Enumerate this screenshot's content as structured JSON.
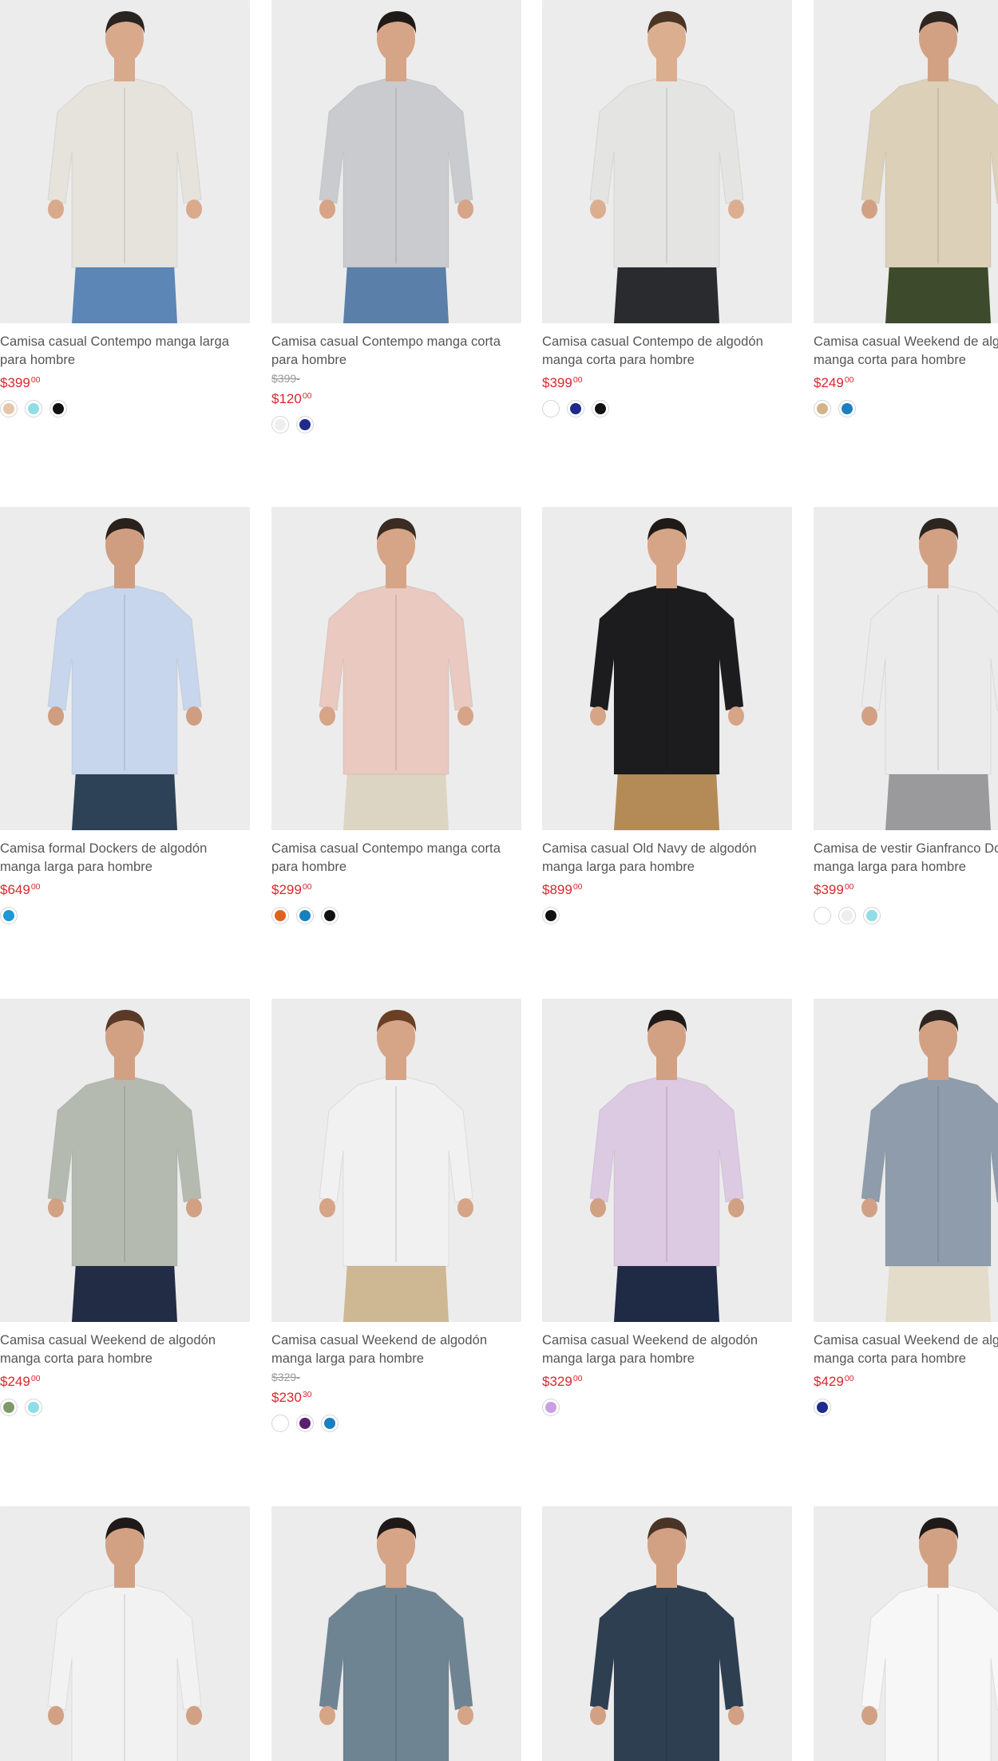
{
  "products": [
    {
      "title": "Camisa casual Contempo manga larga para hombre",
      "old": "",
      "price": "$399",
      "cents": "00",
      "swatches": [
        "#e8c4a8",
        "#8fdde8",
        "#111111"
      ],
      "shirt": "#e6e3dc",
      "pants": "#5b86b5",
      "skin": "#d9a98c",
      "hair": "#2a2420"
    },
    {
      "title": "Camisa casual Contempo manga corta para hombre",
      "old": "$399-",
      "price": "$120",
      "cents": "00",
      "swatches": [
        "#eeeeee",
        "#1e2a8c"
      ],
      "shirt": "#c9cbcf",
      "pants": "#5a7fa8",
      "skin": "#d6a486",
      "hair": "#1f1a18"
    },
    {
      "title": "Camisa casual Contempo de algodón manga corta para hombre",
      "old": "",
      "price": "$399",
      "cents": "00",
      "swatches": [
        "#ffffff",
        "#1e2a8c",
        "#111111"
      ],
      "shirt": "#e4e5e2",
      "pants": "#2a2b2e",
      "skin": "#dcae90",
      "hair": "#4a3426"
    },
    {
      "title": "Camisa casual Weekend de algodón manga corta para hombre",
      "old": "",
      "price": "$249",
      "cents": "00",
      "swatches": [
        "#d3b48a",
        "#1a7fc0"
      ],
      "shirt": "#dcd0b8",
      "pants": "#3d4a2b",
      "skin": "#d2a184",
      "hair": "#2d2520"
    },
    {
      "title": "Camisa formal Dockers de algodón manga larga para hombre",
      "old": "",
      "price": "$649",
      "cents": "00",
      "swatches": [
        "#1a9ad6"
      ],
      "shirt": "#c7d6ec",
      "pants": "#2d4256",
      "skin": "#cf9e80",
      "hair": "#2a211c"
    },
    {
      "title": "Camisa casual Contempo manga corta para hombre",
      "old": "",
      "price": "$299",
      "cents": "00",
      "swatches": [
        "#e0621e",
        "#1a7fc0",
        "#111111"
      ],
      "shirt": "#e9c9c0",
      "pants": "#ddd5c3",
      "skin": "#d6a486",
      "hair": "#3a2c22"
    },
    {
      "title": "Camisa casual Old Navy de algodón manga larga para hombre",
      "old": "",
      "price": "$899",
      "cents": "00",
      "swatches": [
        "#111111"
      ],
      "shirt": "#1c1c1e",
      "pants": "#b48b57",
      "skin": "#d6a486",
      "hair": "#1f1a18"
    },
    {
      "title": "Camisa de vestir Gianfranco Dormi manga larga para hombre",
      "old": "",
      "price": "$399",
      "cents": "00",
      "swatches": [
        "#ffffff",
        "#eeeeee",
        "#8fdde8"
      ],
      "shirt": "#ebebec",
      "pants": "#9a9a9c",
      "skin": "#d2a184",
      "hair": "#2d2520"
    },
    {
      "title": "Camisa casual Weekend de algodón manga corta para hombre",
      "old": "",
      "price": "$249",
      "cents": "00",
      "swatches": [
        "#7f9a68",
        "#8fdde8"
      ],
      "shirt": "#b4bab0",
      "pants": "#222c44",
      "skin": "#d2a184",
      "hair": "#5a3a26"
    },
    {
      "title": "Camisa casual Weekend de algodón manga larga para hombre",
      "old": "$329-",
      "price": "$230",
      "cents": "30",
      "swatches": [
        "#ffffff",
        "#5a1f6e",
        "#1a7fc0"
      ],
      "shirt": "#f1f1f1",
      "pants": "#cdb893",
      "skin": "#d6a486",
      "hair": "#6b3f24"
    },
    {
      "title": "Camisa casual Weekend de algodón manga larga para hombre",
      "old": "",
      "price": "$329",
      "cents": "00",
      "swatches": [
        "#c8a0e0"
      ],
      "shirt": "#dcc9e2",
      "pants": "#1f2a44",
      "skin": "#d2a184",
      "hair": "#1f1a18"
    },
    {
      "title": "Camisa casual Weekend de algodón manga corta para hombre",
      "old": "",
      "price": "$429",
      "cents": "00",
      "swatches": [
        "#1e2a8c"
      ],
      "shirt": "#8e9cab",
      "pants": "#e3dccb",
      "skin": "#d2a184",
      "hair": "#2d2520"
    },
    {
      "title": "",
      "old": "",
      "price": "",
      "cents": "",
      "swatches": [],
      "shirt": "#f2f2f2",
      "pants": "#cccccc",
      "skin": "#d2a184",
      "hair": "#1f1a18"
    },
    {
      "title": "",
      "old": "",
      "price": "",
      "cents": "",
      "swatches": [],
      "shirt": "#6f8492",
      "pants": "#444444",
      "skin": "#d6a486",
      "hair": "#1f1a18"
    },
    {
      "title": "",
      "old": "",
      "price": "",
      "cents": "",
      "swatches": [],
      "shirt": "#2f3f52",
      "pants": "#444444",
      "skin": "#d2a184",
      "hair": "#4a3426"
    },
    {
      "title": "",
      "old": "",
      "price": "",
      "cents": "",
      "swatches": [],
      "shirt": "#f7f7f8",
      "pants": "#cccccc",
      "skin": "#d2a184",
      "hair": "#1f1a18"
    }
  ]
}
